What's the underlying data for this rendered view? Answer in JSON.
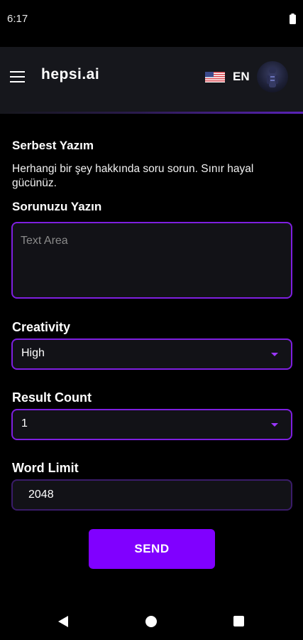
{
  "status_bar": {
    "time": "6:17",
    "battery_icon": "battery-icon"
  },
  "header": {
    "brand": "hepsi.ai",
    "menu_icon": "menu-icon",
    "flag_icon": "us-flag-icon",
    "language": "EN",
    "avatar_icon": "avatar"
  },
  "page": {
    "title": "Serbest Yazım",
    "description": "Herhangi bir şey hakkında soru sorun. Sınır hayal gücünüz.",
    "question_label": "Sorunuzu Yazın",
    "question_placeholder": "Text Area",
    "question_value": ""
  },
  "form": {
    "creativity": {
      "label": "Creativity",
      "value": "High"
    },
    "result_count": {
      "label": "Result Count",
      "value": "1"
    },
    "word_limit": {
      "label": "Word Limit",
      "value": "2048"
    },
    "send_label": "SEND"
  },
  "nav_bar": {
    "back_icon": "back-icon",
    "home_icon": "home-icon",
    "recents_icon": "recents-icon"
  },
  "colors": {
    "accent": "#8000ff",
    "border": "#7e1fe0",
    "background": "#000000",
    "header_bg": "#16171c"
  }
}
